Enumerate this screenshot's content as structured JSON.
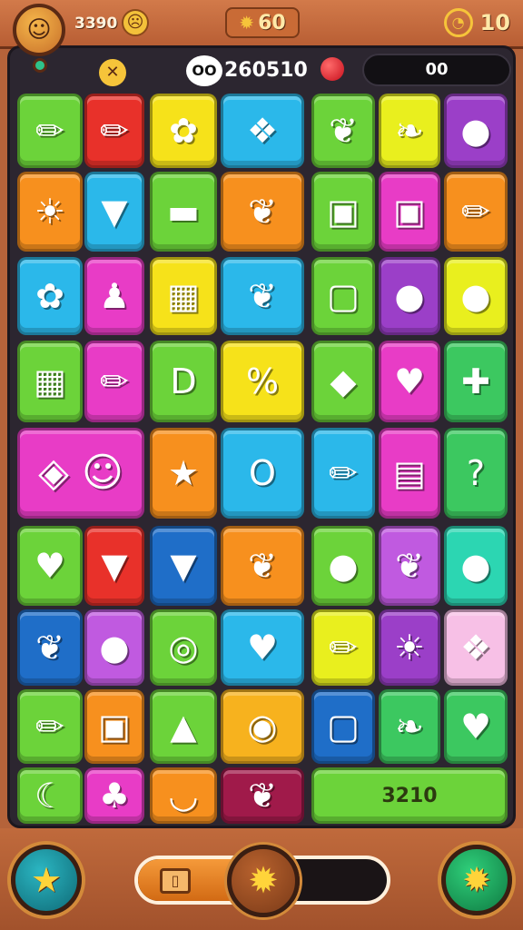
{
  "header": {
    "score": "3390",
    "face_icon": "sad-face-icon",
    "center_value": "60",
    "center_icon": "gear-icon",
    "timer_icon": "timer-icon",
    "timer_value": "10"
  },
  "subheader": {
    "close_icon": "close-icon",
    "eyes_icon": "eyes-icon",
    "eyes_text": "OO",
    "score": "260510",
    "ball_icon": "red-ball-icon",
    "pill_value": "00"
  },
  "board": {
    "tiles": [
      {
        "row": 0,
        "col": 0,
        "color": "#6cd33a",
        "icon": "crayon-icon",
        "glyph": "✏"
      },
      {
        "row": 0,
        "col": 1,
        "color": "#e8312a",
        "icon": "crayon-icon",
        "glyph": "✏"
      },
      {
        "row": 0,
        "col": 2,
        "color": "#f6e21a",
        "icon": "gear-flower-icon",
        "glyph": "✿"
      },
      {
        "row": 0,
        "col": 3,
        "color": "#2bb8ea",
        "icon": "candy-icon",
        "glyph": "❖"
      },
      {
        "row": 0,
        "col": 4,
        "color": "#6cd33a",
        "icon": "leaf-icon",
        "glyph": "❦"
      },
      {
        "row": 0,
        "col": 5,
        "color": "#e9ef1e",
        "icon": "pepper-icon",
        "glyph": "❧"
      },
      {
        "row": 0,
        "col": 6,
        "color": "#9b3fc8",
        "icon": "apple-icon",
        "glyph": "●"
      },
      {
        "row": 1,
        "col": 0,
        "color": "#f7901e",
        "icon": "sun-icon",
        "glyph": "☀"
      },
      {
        "row": 1,
        "col": 1,
        "color": "#2bb8ea",
        "icon": "carrot-icon",
        "glyph": "▼"
      },
      {
        "row": 1,
        "col": 2,
        "color": "#6cd33a",
        "icon": "pot-icon",
        "glyph": "▬"
      },
      {
        "row": 1,
        "col": 3,
        "color": "#f7901e",
        "icon": "leaf-icon",
        "glyph": "❦"
      },
      {
        "row": 1,
        "col": 4,
        "color": "#6cd33a",
        "icon": "jar-icon",
        "glyph": "▣"
      },
      {
        "row": 1,
        "col": 5,
        "color": "#e83cc6",
        "icon": "jar-icon",
        "glyph": "▣"
      },
      {
        "row": 1,
        "col": 6,
        "color": "#f7901e",
        "icon": "pencil-icon",
        "glyph": "✏"
      },
      {
        "row": 2,
        "col": 0,
        "color": "#2bb8ea",
        "icon": "flower-icon",
        "glyph": "✿"
      },
      {
        "row": 2,
        "col": 1,
        "color": "#e83cc6",
        "icon": "bottle-icon",
        "glyph": "♟"
      },
      {
        "row": 2,
        "col": 2,
        "color": "#f6e21a",
        "icon": "gift-box-icon",
        "glyph": "▦"
      },
      {
        "row": 2,
        "col": 3,
        "color": "#2bb8ea",
        "icon": "leaf-icon",
        "glyph": "❦"
      },
      {
        "row": 2,
        "col": 4,
        "color": "#6cd33a",
        "icon": "box-icon",
        "glyph": "▢"
      },
      {
        "row": 2,
        "col": 5,
        "color": "#9b3fc8",
        "icon": "speech-bubble-icon",
        "glyph": "●"
      },
      {
        "row": 2,
        "col": 6,
        "color": "#e9ef1e",
        "icon": "apple-icon",
        "glyph": "●"
      },
      {
        "row": 3,
        "col": 0,
        "color": "#6cd33a",
        "icon": "popcorn-box-icon",
        "glyph": "▦"
      },
      {
        "row": 3,
        "col": 1,
        "color": "#e83cc6",
        "icon": "crayon-icon",
        "glyph": "✏"
      },
      {
        "row": 3,
        "col": 2,
        "color": "#6cd33a",
        "icon": "letter-d-icon",
        "glyph": "D"
      },
      {
        "row": 3,
        "col": 3,
        "color": "#f6e21a",
        "icon": "percent-icon",
        "glyph": "%"
      },
      {
        "row": 3,
        "col": 4,
        "color": "#6cd33a",
        "icon": "cube-icon",
        "glyph": "◆"
      },
      {
        "row": 3,
        "col": 5,
        "color": "#e83cc6",
        "icon": "heart-icon",
        "glyph": "♥"
      },
      {
        "row": 3,
        "col": 6,
        "color": "#3cc860",
        "icon": "puzzle-icon",
        "glyph": "✚"
      },
      {
        "row": 4,
        "col": 0,
        "span": 2,
        "color": "#e83cc6",
        "icon": "gem-face-icon",
        "glyph": "◈ ☺"
      },
      {
        "row": 4,
        "col": 2,
        "color": "#f7901e",
        "icon": "star-icon",
        "glyph": "★"
      },
      {
        "row": 4,
        "col": 3,
        "color": "#2bb8ea",
        "icon": "ring-icon",
        "glyph": "O"
      },
      {
        "row": 4,
        "col": 4,
        "color": "#2bb8ea",
        "icon": "pencil-icon",
        "glyph": "✏"
      },
      {
        "row": 4,
        "col": 5,
        "color": "#e83cc6",
        "icon": "card-icon",
        "glyph": "▤"
      },
      {
        "row": 4,
        "col": 6,
        "color": "#3cc860",
        "icon": "question-icon",
        "glyph": "?"
      },
      {
        "row": 5,
        "col": 0,
        "color": "#6cd33a",
        "icon": "heart-icon",
        "glyph": "♥"
      },
      {
        "row": 5,
        "col": 1,
        "color": "#e8312a",
        "icon": "ice-cream-icon",
        "glyph": "▼"
      },
      {
        "row": 5,
        "col": 2,
        "color": "#1f6ec8",
        "icon": "carrot-icon",
        "glyph": "▼"
      },
      {
        "row": 5,
        "col": 3,
        "color": "#f7901e",
        "icon": "leaf-icon",
        "glyph": "❦"
      },
      {
        "row": 5,
        "col": 4,
        "color": "#6cd33a",
        "icon": "plum-icon",
        "glyph": "●"
      },
      {
        "row": 5,
        "col": 5,
        "color": "#c05ae0",
        "icon": "leaf-icon",
        "glyph": "❦"
      },
      {
        "row": 5,
        "col": 6,
        "color": "#2cd6b2",
        "icon": "apple-icon",
        "glyph": "●"
      },
      {
        "row": 6,
        "col": 0,
        "color": "#1f6ec8",
        "icon": "leaf-icon",
        "glyph": "❦"
      },
      {
        "row": 6,
        "col": 1,
        "color": "#c05ae0",
        "icon": "orange-icon",
        "glyph": "●"
      },
      {
        "row": 6,
        "col": 2,
        "color": "#6cd33a",
        "icon": "ring-icon",
        "glyph": "◎"
      },
      {
        "row": 6,
        "col": 3,
        "color": "#2bb8ea",
        "icon": "heart-icon",
        "glyph": "♥"
      },
      {
        "row": 6,
        "col": 4,
        "color": "#e9ef1e",
        "icon": "pencil-icon",
        "glyph": "✏"
      },
      {
        "row": 6,
        "col": 5,
        "color": "#9b3fc8",
        "icon": "sun-icon",
        "glyph": "☀"
      },
      {
        "row": 6,
        "col": 6,
        "color": "#f7c0e6",
        "icon": "candy-icon",
        "glyph": "❖"
      },
      {
        "row": 7,
        "col": 0,
        "color": "#6cd33a",
        "icon": "crayon-icon",
        "glyph": "✏"
      },
      {
        "row": 7,
        "col": 1,
        "color": "#f7901e",
        "icon": "jar-icon",
        "glyph": "▣"
      },
      {
        "row": 7,
        "col": 2,
        "color": "#6cd33a",
        "icon": "hat-icon",
        "glyph": "▲"
      },
      {
        "row": 7,
        "col": 3,
        "color": "#f7b21e",
        "icon": "creature-icon",
        "glyph": "◉"
      },
      {
        "row": 7,
        "col": 4,
        "color": "#1f6ec8",
        "icon": "box-icon",
        "glyph": "▢"
      },
      {
        "row": 7,
        "col": 5,
        "color": "#3cc860",
        "icon": "pepper-icon",
        "glyph": "❧"
      },
      {
        "row": 7,
        "col": 6,
        "color": "#3cc860",
        "icon": "heart-icon",
        "glyph": "♥"
      },
      {
        "row": 8,
        "col": 0,
        "color": "#6cd33a",
        "icon": "banana-icon",
        "glyph": "☾"
      },
      {
        "row": 8,
        "col": 1,
        "color": "#e83cc6",
        "icon": "fruit-icon",
        "glyph": "♣"
      },
      {
        "row": 8,
        "col": 2,
        "color": "#f7901e",
        "icon": "bowl-icon",
        "glyph": "◡"
      },
      {
        "row": 8,
        "col": 3,
        "color": "#a01a4a",
        "icon": "radish-icon",
        "glyph": "❦"
      }
    ],
    "score_tile": {
      "label": "3210"
    }
  },
  "footer": {
    "star_button_icon": "star-icon",
    "star_glyph": "★",
    "sun_button_icon": "sun-icon",
    "sun_glyph": "✹",
    "progress_icon": "book-icon",
    "progress_glyph": "▯▯",
    "knob_icon": "gear-icon",
    "knob_glyph": "✹",
    "progress_fraction": 0.45
  },
  "colors": {
    "background": "#b5633a",
    "board": "#2c2630",
    "accent_gold": "#f6c43a"
  }
}
